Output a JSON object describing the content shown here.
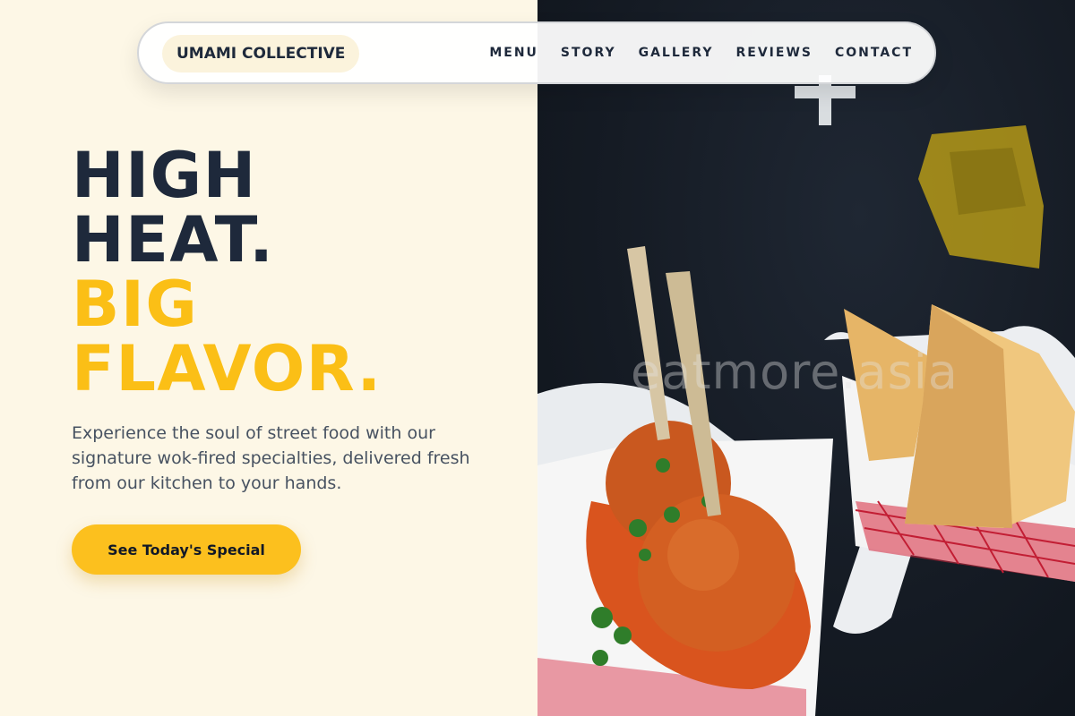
{
  "brand": {
    "name": "UMAMI COLLECTIVE"
  },
  "nav": {
    "items": [
      "MENU",
      "STORY",
      "GALLERY",
      "REVIEWS",
      "CONTACT"
    ]
  },
  "hero": {
    "line1": "HIGH",
    "line2": "HEAT.",
    "line3": "BIG",
    "line4": "FLAVOR.",
    "description": "Experience the soul of street food with our signature wok-fired specialties, delivered fresh from our kitchen to your hands.",
    "cta_label": "See Today's Special"
  },
  "photo": {
    "watermark": "eatmore.asia"
  },
  "colors": {
    "accent": "#fbbf16",
    "dark": "#1e293b",
    "cream": "#fdf7e6"
  }
}
